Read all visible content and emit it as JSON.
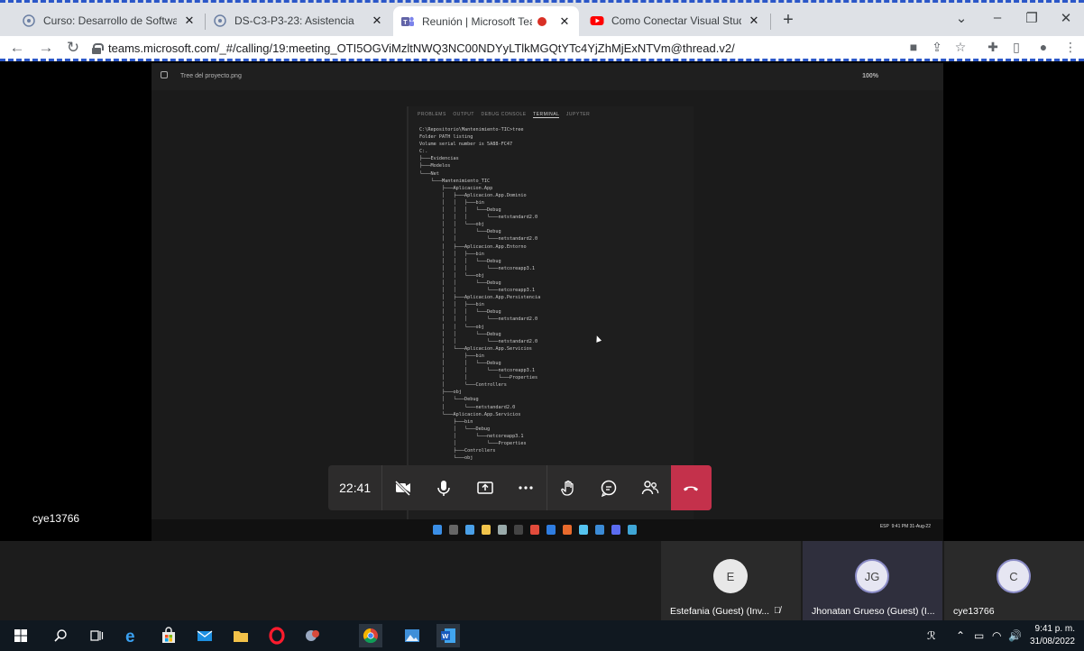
{
  "browser": {
    "tabs": [
      {
        "title": "Curso: Desarrollo de Software - C",
        "favicon": "course-icon",
        "active": false
      },
      {
        "title": "DS-C3-P3-23: Asistencia",
        "favicon": "course-icon",
        "active": false
      },
      {
        "title": "Reunión | Microsoft Teams",
        "favicon": "teams-icon",
        "active": true,
        "recording": true
      },
      {
        "title": "Como Conectar Visual Studio Co",
        "favicon": "youtube-icon",
        "active": false
      }
    ],
    "new_tab": "+",
    "window_controls": {
      "tab_search": "⌄",
      "minimize": "–",
      "restore": "❐",
      "close": "✕"
    },
    "url": "teams.microsoft.com/_#/calling/19:meeting_OTI5OGViMzltNWQ3NC00NDYyLTlkMGQtYTc4YjZhMjExNTVm@thread.v2/"
  },
  "shared_screen": {
    "file_name": "Tree del proyecto.png",
    "zoom": "100%",
    "terminal_tabs": [
      "PROBLEMS",
      "OUTPUT",
      "DEBUG CONSOLE",
      "TERMINAL",
      "JUPYTER"
    ],
    "terminal_text": "C:\\Repositorio\\Mantenimiento-TIC>tree\nFolder PATH listing\nVolume serial number is 5A88-FC47\nC:.\n├───Evidencias\n├───Modelos\n└───Net\n    └───Mantenimiento_TIC\n        ├───Aplicacion.App\n        │   ├───Aplicacion.App.Dominio\n        │   │   ├───bin\n        │   │   │   └───Debug\n        │   │   │       └───netstandard2.0\n        │   │   └───obj\n        │   │       └───Debug\n        │   │           └───netstandard2.0\n        │   ├───Aplicacion.App.Entorno\n        │   │   ├───bin\n        │   │   │   └───Debug\n        │   │   │       └───netcoreapp3.1\n        │   │   └───obj\n        │   │       └───Debug\n        │   │           └───netcoreapp3.1\n        │   ├───Aplicacion.App.Persistencia\n        │   │   ├───bin\n        │   │   │   └───Debug\n        │   │   │       └───netstandard2.0\n        │   │   └───obj\n        │   │       └───Debug\n        │   │           └───netstandard2.0\n        │   └───Aplicacion.App.Servicios\n        │       ├───bin\n        │       │   └───Debug\n        │       │       └───netcoreapp3.1\n        │       │           └───Properties\n        │       └───Controllers\n        ├───obj\n        │   └───Debug\n        │       └───netstandard2.0\n        └───Aplicacion.App.Servicios\n            ├───bin\n            │   └───Debug\n            │       └───netcoreapp3.1\n            │           └───Properties\n            ├───Controllers\n            └───obj",
    "remote_clock": {
      "time": "9:41 PM",
      "date": "31-Aug-22",
      "lang": "ESP"
    }
  },
  "presenter_name": "cye13766",
  "controls": {
    "elapsed_time": "22:41",
    "buttons": [
      "camera-off",
      "microphone",
      "share",
      "more",
      "raise-hand",
      "chat",
      "participants",
      "leave"
    ]
  },
  "participants": [
    {
      "initials": "E",
      "name": "Estefania (Guest) (Inv...",
      "muted": true
    },
    {
      "initials": "JG",
      "name": "Jhonatan Grueso (Guest) (I...",
      "muted": false
    },
    {
      "initials": "C",
      "name": "cye13766",
      "muted": false
    }
  ],
  "taskbar": {
    "clock_time": "9:41 p. m.",
    "clock_date": "31/08/2022"
  },
  "colors": {
    "teams_purple": "#6264a7",
    "hangup_red": "#c4314b",
    "avatar_bg": "#e8e8e8",
    "avatar_ring": "#8b8cc7"
  }
}
